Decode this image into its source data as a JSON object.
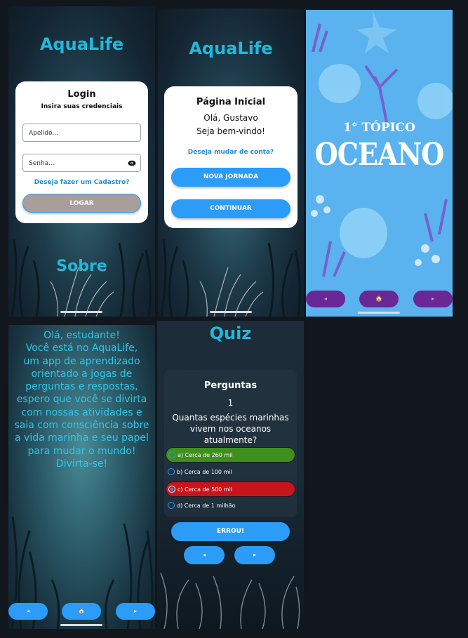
{
  "login": {
    "app_title": "AquaLife",
    "card_title": "Login",
    "card_subtitle": "Insira suas credenciais",
    "username_placeholder": "Apelido...",
    "password_placeholder": "Senha...",
    "signup_link": "Deseja fazer um Cadastro?",
    "login_button": "LOGAR",
    "about_link": "Sobre"
  },
  "home": {
    "app_title": "AquaLife",
    "card_title": "Página Inicial",
    "greeting": "Olá, Gustavo",
    "welcome": "Seja bem-vindo!",
    "switch_account_link": "Deseja mudar de conta?",
    "new_journey_button": "NOVA JORNADA",
    "continue_button": "CONTINUAR"
  },
  "topic": {
    "topic_number": "1° TÓPICO",
    "topic_name": "OCEANO",
    "prev_label": "◂",
    "home_label": "🏠",
    "next_label": "▸"
  },
  "about": {
    "lines": [
      "Olá, estudante!",
      "Você está no AquaLife,",
      "um app de aprendizado",
      "orientado a jogas de",
      "perguntas e respostas,",
      "espero que você se divirta",
      "com nossas atividades e",
      "saia com consciência sobre",
      "a vida marinha e seu papel",
      "para mudar o mundo!",
      "Divirta-se!"
    ],
    "prev_label": "◂",
    "home_label": "🏠",
    "next_label": "▸"
  },
  "quiz": {
    "title": "Quiz",
    "card_title": "Perguntas",
    "question_number": "1",
    "question": "Quantas espécies marinhas vivem nos oceanos atualmente?",
    "options": [
      {
        "label": "a) Cerca de 260 mil",
        "state": "correct"
      },
      {
        "label": "b) Cerca de 100 mil",
        "state": "neutral"
      },
      {
        "label": "c) Cerca de 500 mil",
        "state": "wrong-selected"
      },
      {
        "label": "d) Cerca de 1 milhão",
        "state": "neutral"
      }
    ],
    "result_button": "ERROU!",
    "prev_label": "◂",
    "next_label": "▸"
  },
  "colors": {
    "accent": "#2b9cf7",
    "title": "#22b8d9",
    "correct": "#3f8f1f",
    "wrong": "#c8151b",
    "topic_bg": "#5ab2ee",
    "topic_nav": "#6a2796"
  }
}
